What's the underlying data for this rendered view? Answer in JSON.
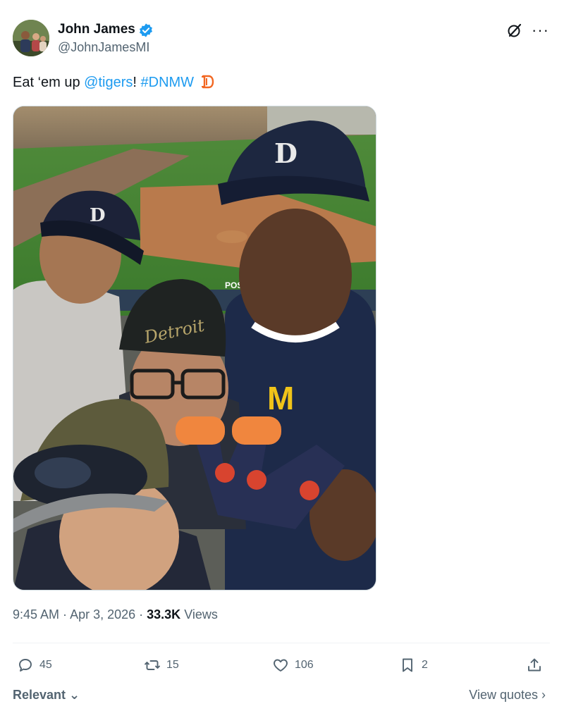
{
  "author": {
    "name": "John James",
    "handle": "@JohnJamesMI",
    "verified_color": "#1d9bf0"
  },
  "tweet": {
    "text_prefix": "Eat ‘em up ",
    "mention": "@tigers",
    "text_mid": "! ",
    "hashtag": "#DNMW",
    "emoji_icon": "tigers-d-logo-icon",
    "accent_color": "#1d9bf0"
  },
  "photo": {
    "cap_logo": "D",
    "cap_script": "Detroit",
    "shirt_logo": "M",
    "sign_text": "POS"
  },
  "meta": {
    "time": "9:45 AM",
    "sep1": " · ",
    "date": "Apr 3, 2026",
    "sep2": " · ",
    "views_count": "33.3K",
    "views_label": " Views"
  },
  "actions": {
    "replies": "45",
    "reposts": "15",
    "likes": "106",
    "bookmarks": "2"
  },
  "footer": {
    "sort_label": "Relevant",
    "view_quotes": "View quotes"
  }
}
